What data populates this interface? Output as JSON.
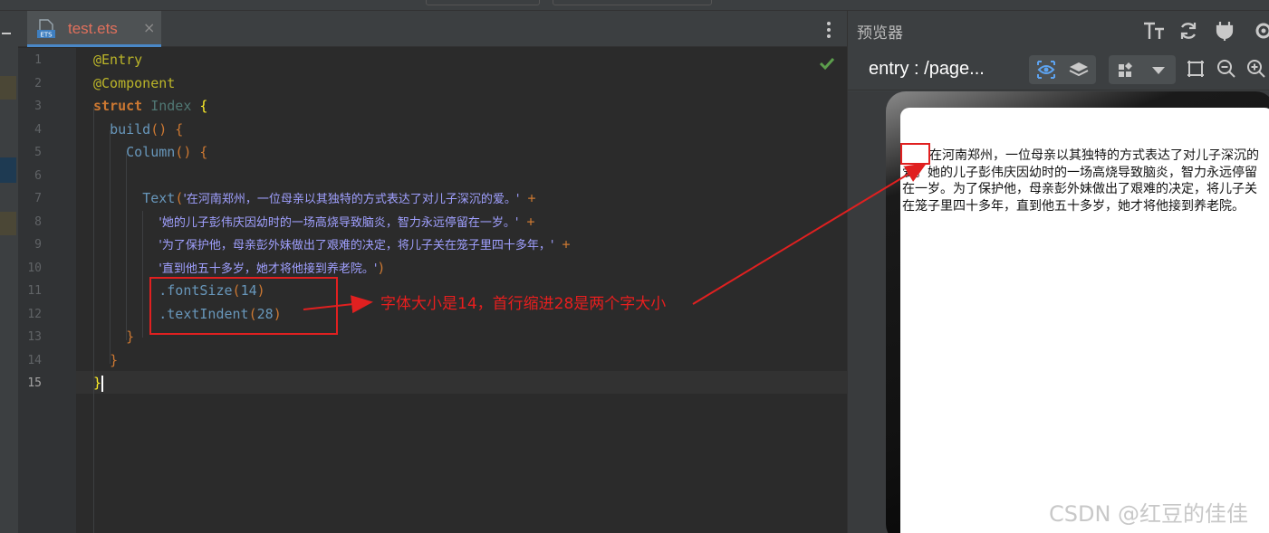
{
  "editor": {
    "tab_label": "test.ets",
    "tab_close": "×",
    "file_icon_text": "ETS",
    "line_numbers": [
      "1",
      "2",
      "3",
      "4",
      "5",
      "6",
      "7",
      "8",
      "9",
      "10",
      "11",
      "12",
      "13",
      "14",
      "15"
    ],
    "code": {
      "l1": "@Entry",
      "l2": "@Component",
      "l3_kw": "struct",
      "l3_name": " Index ",
      "l3_brace": "{",
      "l4_fn": "build",
      "l4_rest": "() {",
      "l5_fn": "Column",
      "l5_rest": "() {",
      "l7_fn": "Text",
      "l7_paren": "(",
      "l7_str": "'在河南郑州，一位母亲以其独特的方式表达了对儿子深沉的爱。'",
      "l8_str": "'她的儿子彭伟庆因幼时的一场高烧导致脑炎，智力永远停留在一岁。'",
      "l9_str": "'为了保护他，母亲彭外妹做出了艰难的决定，将儿子关在笼子里四十多年，'",
      "l10_str": "'直到他五十多岁，她才将他接到养老院。'",
      "l10_paren": ")",
      "plus": "+",
      "l11_method": ".fontSize",
      "l11_open": "(",
      "l11_num": "14",
      "l11_close": ")",
      "l12_method": ".textIndent",
      "l12_open": "(",
      "l12_num": "28",
      "l12_close": ")",
      "l13": "}",
      "l14": "}",
      "l15": "}"
    }
  },
  "preview": {
    "title": "预览器",
    "entry_label": "entry : /page...",
    "screen_text": "在河南郑州，一位母亲以其独特的方式表达了对儿子深沉的爱。她的儿子彭伟庆因幼时的一场高烧导致脑炎，智力永远停留在一岁。为了保护他，母亲彭外妹做出了艰难的决定，将儿子关在笼子里四十多年，直到他五十多岁，她才将他接到养老院。"
  },
  "annotation": {
    "note": "字体大小是14，首行缩进28是两个字大小"
  },
  "watermark": "CSDN @红豆的佳佳",
  "colors": {
    "editor_bg": "#2b2b2b",
    "annotation_red": "#e02020",
    "tab_text": "#e0705c",
    "string": "#a0a0ff"
  }
}
